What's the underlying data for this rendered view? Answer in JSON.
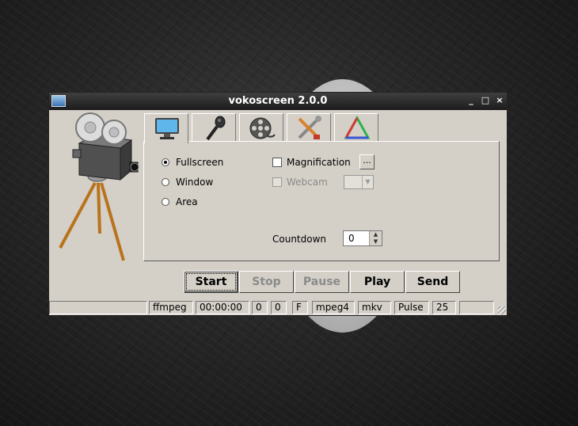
{
  "window": {
    "title": "vokoscreen 2.0.0",
    "minimize": "_",
    "maximize": "□",
    "close": "×"
  },
  "tabs": [
    {
      "name": "screen-tab",
      "icon": "monitor-icon"
    },
    {
      "name": "audio-tab",
      "icon": "microphone-icon"
    },
    {
      "name": "video-tab",
      "icon": "film-reel-icon"
    },
    {
      "name": "settings-tab",
      "icon": "tools-icon"
    },
    {
      "name": "about-tab",
      "icon": "triangle-logo-icon"
    }
  ],
  "capture": {
    "fullscreen": "Fullscreen",
    "window": "Window",
    "area": "Area",
    "selected": "fullscreen"
  },
  "options": {
    "magnification": "Magnification",
    "magnification_more": "...",
    "webcam": "Webcam",
    "countdown_label": "Countdown",
    "countdown_value": "0"
  },
  "buttons": {
    "start": "Start",
    "stop": "Stop",
    "pause": "Pause",
    "play": "Play",
    "send": "Send"
  },
  "statusbar": {
    "encoder": "ffmpeg",
    "time": "00:00:00",
    "val1": "0",
    "val2": "0",
    "mode": "F",
    "codec": "mpeg4",
    "format": "mkv",
    "audio": "Pulse",
    "fps": "25"
  }
}
